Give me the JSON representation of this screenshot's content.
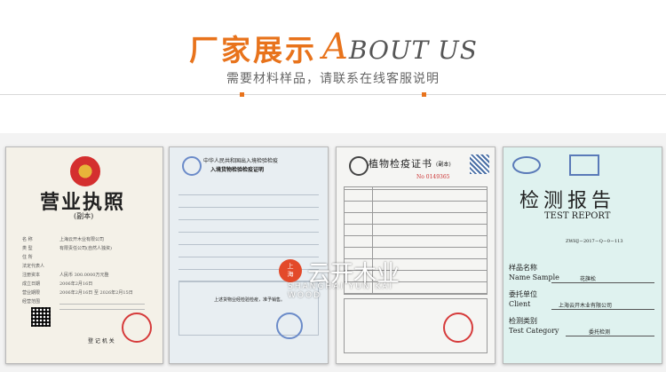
{
  "header": {
    "title_cn": "厂家展示",
    "title_en_big_a": "A",
    "title_en_rest_a": "BOUT ",
    "title_en_rest_b": "US",
    "subtitle": "需要材料样品，请联系在线客服说明"
  },
  "colors": {
    "accent": "#e8731c",
    "strip": "#f3f3f3"
  },
  "certificates": [
    {
      "name": "business-license",
      "title": "营业执照",
      "sub": "(副本)",
      "fields": [
        "名 称",
        "类 型",
        "住 所",
        "法定代表人",
        "注册资本",
        "成立日期",
        "营业期限",
        "经营范围"
      ],
      "values": [
        "上海云开木业有限公司",
        "有限责任公司(自然人独资)",
        "",
        "",
        "人民币 300.0000万元整",
        "2006年2月16日",
        "2006年2月16日 至 2026年2月15日",
        ""
      ],
      "footer": "登 记 机 关"
    },
    {
      "name": "inspection-certificate",
      "header1": "中华人民共和国出入境检验检疫",
      "header2": "入境货物检验检疫证明",
      "footer": "上述货物业经检验检疫，准予销售。"
    },
    {
      "name": "plant-quarantine",
      "title": "植物检疫证书",
      "sub": "(副本)",
      "number": "No 0149365"
    },
    {
      "name": "test-report",
      "title": "检测报告",
      "sub": "TEST REPORT",
      "code": "ZWHJ－2017－Q－0－113",
      "labels": [
        "样品名称",
        "Name Sample",
        "委托单位",
        "Client",
        "检测类别",
        "Test Category"
      ],
      "values": [
        "",
        "花旗松",
        "",
        "上海云开木业有限公司",
        "",
        "委托检测"
      ]
    }
  ],
  "watermark": {
    "badge_line1": "上",
    "badge_line2": "海",
    "text": "云开木业",
    "sub": "SHANGHAI YUN KAI WOOD"
  }
}
